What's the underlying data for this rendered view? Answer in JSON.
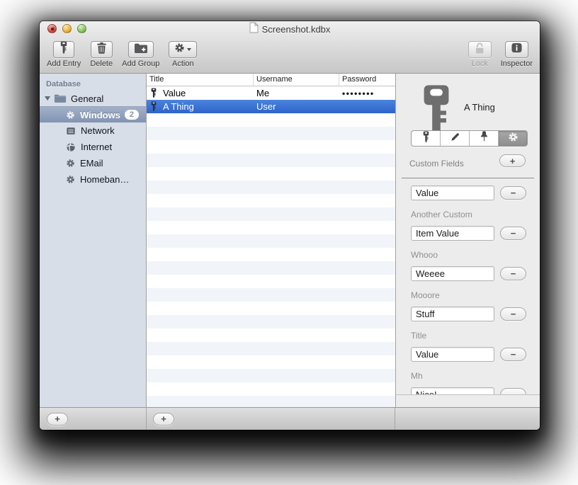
{
  "colors": {
    "selection_blue": "#3a72d8",
    "sidebar_selection_top": "#a2b1c9",
    "sidebar_selection_bottom": "#8294b3",
    "sidebar_bg": "#d7dee7",
    "inspector_bg": "#ececec",
    "chrome_gradient_top": "#efefef",
    "chrome_gradient_bottom": "#c7c7c7"
  },
  "titlebar": {
    "title": "Screenshot.kdbx"
  },
  "toolbar": {
    "add_entry": "Add Entry",
    "delete": "Delete",
    "add_group": "Add Group",
    "action": "Action",
    "lock": "Lock",
    "inspector": "Inspector"
  },
  "sidebar": {
    "header": "Database",
    "group": "General",
    "items": [
      {
        "label": "Windows",
        "icon": "gear-icon",
        "badge": "2",
        "selected": true
      },
      {
        "label": "Network",
        "icon": "network-icon"
      },
      {
        "label": "Internet",
        "icon": "globe-icon"
      },
      {
        "label": "EMail",
        "icon": "gear-icon"
      },
      {
        "label": "Homeban…",
        "icon": "gear-icon"
      }
    ]
  },
  "entry_table": {
    "columns": [
      "Title",
      "Username",
      "Password"
    ],
    "rows": [
      {
        "title": "Value",
        "username": "Me",
        "password": "••••••••",
        "selected": false
      },
      {
        "title": "A Thing",
        "username": "User",
        "password": "",
        "selected": true
      }
    ]
  },
  "inspector": {
    "entry_title": "A Thing",
    "tabs": [
      "key",
      "pencil",
      "pin",
      "gear"
    ],
    "selected_tab": "gear",
    "section": "Custom Fields",
    "fields": [
      {
        "label": "",
        "value": "Value"
      },
      {
        "label": "Another Custom",
        "value": "Item Value"
      },
      {
        "label": "Whooo",
        "value": "Weeee"
      },
      {
        "label": "Mooore",
        "value": "Stuff"
      },
      {
        "label": "Title",
        "value": "Value"
      },
      {
        "label": "Mh",
        "value": "Nice!"
      }
    ]
  },
  "icons": {
    "plus": "+",
    "minus": "−"
  }
}
